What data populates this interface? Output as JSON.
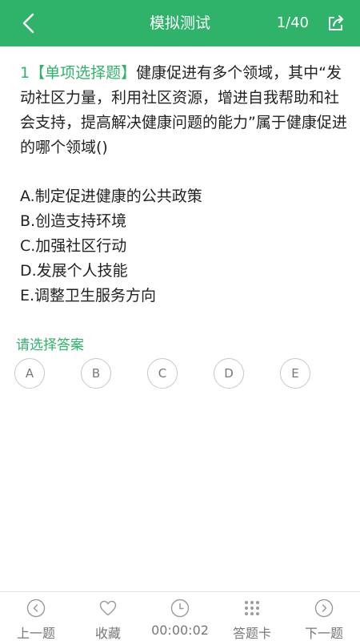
{
  "header": {
    "title": "模拟测试",
    "progress": "1/40",
    "back_icon": "chevron-left-icon",
    "share_icon": "share-icon"
  },
  "question": {
    "number": "1",
    "type": "【单项选择题】",
    "text": "健康促进有多个领域，其中“发动社区力量，利用社区资源，增进自我帮助和社会支持，提高解决健康问题的能力”属于健康促进的哪个领域()"
  },
  "options": [
    "A.制定促进健康的公共政策",
    "B.创造支持环境",
    "C.加强社区行动",
    "D.发展个人技能",
    "E.调整卫生服务方向"
  ],
  "answer_prompt": "请选择答案",
  "answer_choices": [
    "A",
    "B",
    "C",
    "D",
    "E"
  ],
  "tabbar": {
    "prev": "上一题",
    "favorite": "收藏",
    "timer": "00:00:02",
    "answer_card": "答题卡",
    "next": "下一题"
  },
  "colors": {
    "accent": "#2fb36a",
    "text": "#222222",
    "muted": "#777777"
  }
}
